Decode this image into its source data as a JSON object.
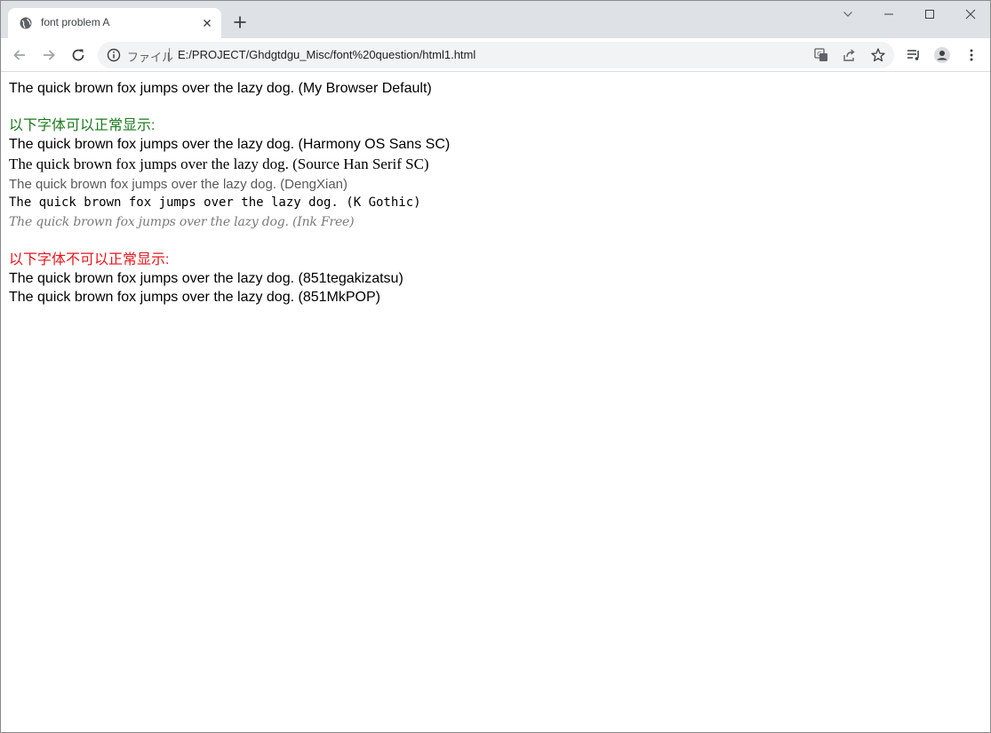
{
  "tab": {
    "title": "font problem A",
    "favicon": "globe-icon"
  },
  "toolbar": {
    "scheme_label": "ファイル",
    "url": "E:/PROJECT/Ghdgtdgu_Misc/font%20question/html1.html"
  },
  "content": {
    "default_line": "The quick brown fox jumps over the lazy dog. (My Browser Default)",
    "ok_heading": "以下字体可以正常显示:",
    "ok_lines": [
      "The quick brown fox jumps over the lazy dog. (Harmony OS Sans SC)",
      "The quick brown fox jumps over the lazy dog. (Source Han Serif SC)",
      "The quick brown fox jumps over the lazy dog. (DengXian)",
      "The quick brown fox jumps over the lazy dog. (K Gothic)",
      "The quick brown fox jumps over the lazy dog. (Ink Free)"
    ],
    "fail_heading": "以下字体不可以正常显示:",
    "fail_lines": [
      "The quick brown fox jumps over the lazy dog. (851tegakizatsu)",
      "The quick brown fox jumps over the lazy dog. (851MkPOP)"
    ]
  },
  "colors": {
    "ok_heading": "#1b7a1b",
    "fail_heading": "#e8151b"
  }
}
